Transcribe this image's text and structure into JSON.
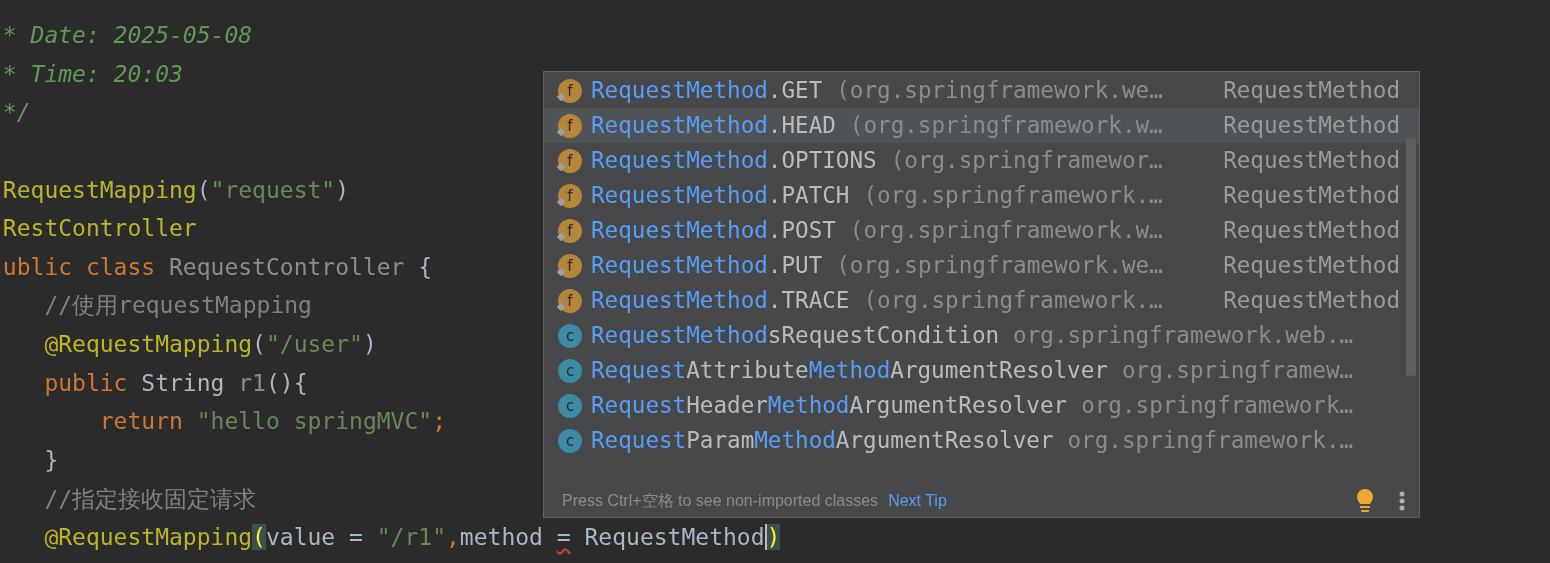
{
  "editor": {
    "lines": [
      {
        "tokens": [
          {
            "kind": "doc",
            "text": " * Date: 2025-05-08"
          }
        ]
      },
      {
        "tokens": [
          {
            "kind": "doc",
            "text": " * Time: 20:03"
          }
        ]
      },
      {
        "tokens": [
          {
            "kind": "doc",
            "text": " */"
          }
        ]
      },
      {
        "gap_before": true,
        "tokens": [
          {
            "kind": "annotation",
            "text": " RequestMapping"
          },
          {
            "kind": "plain",
            "text": "("
          },
          {
            "kind": "string",
            "text": "\"request\""
          },
          {
            "kind": "plain",
            "text": ")"
          }
        ]
      },
      {
        "tokens": [
          {
            "kind": "annotation",
            "text": " RestController"
          }
        ]
      },
      {
        "tokens": [
          {
            "kind": "keyword",
            "text": " ublic class "
          },
          {
            "kind": "muted",
            "text": "RequestController"
          },
          {
            "kind": "plain",
            "text": " {"
          }
        ]
      },
      {
        "tokens": [
          {
            "kind": "comment",
            "text": "    //使用requestMapping"
          }
        ]
      },
      {
        "tokens": [
          {
            "kind": "annotation",
            "text": "    @RequestMapping"
          },
          {
            "kind": "plain",
            "text": "("
          },
          {
            "kind": "string",
            "text": "\"/user\""
          },
          {
            "kind": "plain",
            "text": ")"
          }
        ]
      },
      {
        "tokens": [
          {
            "kind": "keyword",
            "text": "    public "
          },
          {
            "kind": "plain",
            "text": "String "
          },
          {
            "kind": "muted",
            "text": "r1"
          },
          {
            "kind": "plain",
            "text": "(){"
          }
        ]
      },
      {
        "tokens": [
          {
            "kind": "keyword",
            "text": "        return "
          },
          {
            "kind": "string",
            "text": "\"hello springMVC\""
          },
          {
            "kind": "keyword",
            "text": ";"
          }
        ]
      },
      {
        "tokens": [
          {
            "kind": "plain",
            "text": "    }"
          }
        ]
      },
      {
        "tokens": [
          {
            "kind": "comment",
            "text": "    //指定接收固定请求"
          }
        ]
      },
      {
        "tokens": [
          {
            "kind": "annotation",
            "text": "    @RequestMapping"
          },
          {
            "kind": "brace",
            "text": "("
          },
          {
            "kind": "plain",
            "text": "value = "
          },
          {
            "kind": "string",
            "text": "\"/r1\""
          },
          {
            "kind": "keyword",
            "text": ","
          },
          {
            "kind": "plain",
            "text": "method "
          },
          {
            "kind": "warning",
            "text": "="
          },
          {
            "kind": "plain",
            "text": " RequestMethod"
          },
          {
            "kind": "brace_caret",
            "text": ")"
          }
        ]
      }
    ]
  },
  "completion_popup": {
    "items": [
      {
        "kind": "field",
        "badge": "f",
        "selected": false,
        "name_parts": [
          {
            "text": "RequestMethod",
            "matched": true
          },
          {
            "text": ".GET",
            "matched": false
          }
        ],
        "location": "(org.springframework.we…",
        "type": "RequestMethod"
      },
      {
        "kind": "field",
        "badge": "f",
        "selected": true,
        "name_parts": [
          {
            "text": "RequestMethod",
            "matched": true
          },
          {
            "text": ".HEAD",
            "matched": false
          }
        ],
        "location": "(org.springframework.w…",
        "type": "RequestMethod"
      },
      {
        "kind": "field",
        "badge": "f",
        "selected": false,
        "name_parts": [
          {
            "text": "RequestMethod",
            "matched": true
          },
          {
            "text": ".OPTIONS",
            "matched": false
          }
        ],
        "location": "(org.springframewor…",
        "type": "RequestMethod"
      },
      {
        "kind": "field",
        "badge": "f",
        "selected": false,
        "name_parts": [
          {
            "text": "RequestMethod",
            "matched": true
          },
          {
            "text": ".PATCH",
            "matched": false
          }
        ],
        "location": "(org.springframework.…",
        "type": "RequestMethod"
      },
      {
        "kind": "field",
        "badge": "f",
        "selected": false,
        "name_parts": [
          {
            "text": "RequestMethod",
            "matched": true
          },
          {
            "text": ".POST",
            "matched": false
          }
        ],
        "location": "(org.springframework.w…",
        "type": "RequestMethod"
      },
      {
        "kind": "field",
        "badge": "f",
        "selected": false,
        "name_parts": [
          {
            "text": "RequestMethod",
            "matched": true
          },
          {
            "text": ".PUT",
            "matched": false
          }
        ],
        "location": "(org.springframework.we…",
        "type": "RequestMethod"
      },
      {
        "kind": "field",
        "badge": "f",
        "selected": false,
        "name_parts": [
          {
            "text": "RequestMethod",
            "matched": true
          },
          {
            "text": ".TRACE",
            "matched": false
          }
        ],
        "location": "(org.springframework.…",
        "type": "RequestMethod"
      },
      {
        "kind": "class",
        "badge": "c",
        "selected": false,
        "name_parts": [
          {
            "text": "RequestMethod",
            "matched": true
          },
          {
            "text": "sRequestCondition",
            "matched": false
          }
        ],
        "location": "org.springframework.web.…"
      },
      {
        "kind": "class",
        "badge": "c",
        "selected": false,
        "name_parts": [
          {
            "text": "Request",
            "matched": true
          },
          {
            "text": "Attribute",
            "matched": false
          },
          {
            "text": "Method",
            "matched": true
          },
          {
            "text": "ArgumentResolver",
            "matched": false
          }
        ],
        "location": "org.springframew…"
      },
      {
        "kind": "class",
        "badge": "c",
        "selected": false,
        "name_parts": [
          {
            "text": "Request",
            "matched": true
          },
          {
            "text": "Header",
            "matched": false
          },
          {
            "text": "Method",
            "matched": true
          },
          {
            "text": "ArgumentResolver",
            "matched": false
          }
        ],
        "location": "org.springframework…"
      },
      {
        "kind": "class",
        "badge": "c",
        "selected": false,
        "name_parts": [
          {
            "text": "Request",
            "matched": true
          },
          {
            "text": "Param",
            "matched": false
          },
          {
            "text": "Method",
            "matched": true
          },
          {
            "text": "ArgumentResolver",
            "matched": false
          }
        ],
        "location": "org.springframework.…"
      }
    ],
    "footer": {
      "hint": "Press Ctrl+空格 to see non-imported classes",
      "link": "Next Tip"
    }
  }
}
